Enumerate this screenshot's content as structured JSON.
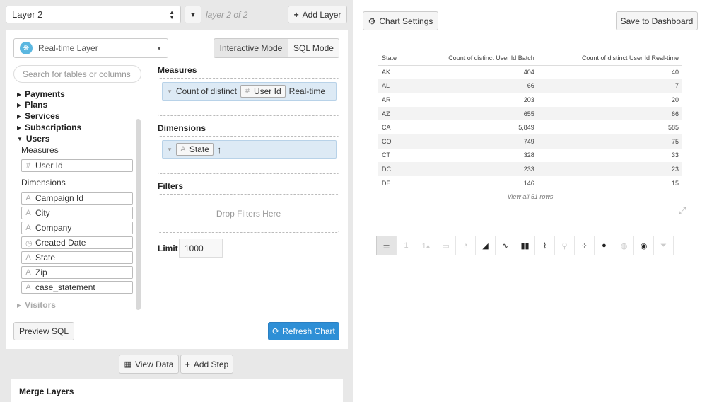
{
  "header": {
    "layer_select": "Layer 2",
    "layer_of": "layer 2 of 2",
    "add_layer": "Add Layer"
  },
  "layer": {
    "type": "Real-time Layer",
    "interactive_mode": "Interactive Mode",
    "sql_mode": "SQL Mode",
    "search_placeholder": "Search for tables or columns"
  },
  "tree": {
    "tables": [
      "Payments",
      "Plans",
      "Services",
      "Subscriptions"
    ],
    "expanded": "Users",
    "measures_label": "Measures",
    "measures": [
      "User Id"
    ],
    "dimensions_label": "Dimensions",
    "dimensions": [
      {
        "label": "Campaign Id",
        "icon": "text-icon"
      },
      {
        "label": "City",
        "icon": "text-icon"
      },
      {
        "label": "Company",
        "icon": "text-icon"
      },
      {
        "label": "Created Date",
        "icon": "clock-icon"
      },
      {
        "label": "State",
        "icon": "text-icon"
      },
      {
        "label": "Zip",
        "icon": "text-icon"
      },
      {
        "label": "case_statement",
        "icon": "text-icon"
      }
    ],
    "collapsed_last": "Visitors"
  },
  "query": {
    "measures_title": "Measures",
    "measure_prefix": "Count of distinct",
    "measure_field": "User Id",
    "measure_suffix": "Real-time",
    "dimensions_title": "Dimensions",
    "dimension_field": "State",
    "filters_title": "Filters",
    "drop_filters": "Drop Filters Here",
    "limit_label": "Limit",
    "limit_value": "1000",
    "preview_sql": "Preview SQL",
    "refresh_chart": "Refresh Chart"
  },
  "footer": {
    "view_data": "View Data",
    "add_step": "Add Step",
    "merge_layers": "Merge Layers"
  },
  "right": {
    "chart_settings": "Chart Settings",
    "save_dashboard": "Save to Dashboard",
    "view_all": "View all 51 rows"
  },
  "table": {
    "headers": [
      "State",
      "Count of distinct User Id Batch",
      "Count of distinct User Id Real-time"
    ],
    "rows": [
      [
        "AK",
        "404",
        "40"
      ],
      [
        "AL",
        "66",
        "7"
      ],
      [
        "AR",
        "203",
        "20"
      ],
      [
        "AZ",
        "655",
        "66"
      ],
      [
        "CA",
        "5,849",
        "585"
      ],
      [
        "CO",
        "749",
        "75"
      ],
      [
        "CT",
        "328",
        "33"
      ],
      [
        "DC",
        "233",
        "23"
      ],
      [
        "DE",
        "146",
        "15"
      ]
    ]
  },
  "chart_types": [
    {
      "name": "table-chart-icon",
      "glyph": "☰",
      "state": "active"
    },
    {
      "name": "number-icon",
      "glyph": "1",
      "state": "off"
    },
    {
      "name": "number-trend-icon",
      "glyph": "1▴",
      "state": "off"
    },
    {
      "name": "progress-icon",
      "glyph": "▭",
      "state": "off"
    },
    {
      "name": "pie-icon",
      "glyph": "◔",
      "state": "off"
    },
    {
      "name": "area-icon",
      "glyph": "◢",
      "state": "on"
    },
    {
      "name": "line-icon",
      "glyph": "∿",
      "state": "on"
    },
    {
      "name": "bar-icon",
      "glyph": "▮▮",
      "state": "on"
    },
    {
      "name": "bar-line-icon",
      "glyph": "⌇",
      "state": "on"
    },
    {
      "name": "funnel-icon",
      "glyph": "⚲",
      "state": "off"
    },
    {
      "name": "scatter-icon",
      "glyph": "⁘",
      "state": "on"
    },
    {
      "name": "bubble-icon",
      "glyph": "●",
      "state": "on"
    },
    {
      "name": "globe-icon",
      "glyph": "◍",
      "state": "off"
    },
    {
      "name": "world-map-icon",
      "glyph": "◉",
      "state": "on"
    },
    {
      "name": "filter-icon",
      "glyph": "⏷",
      "state": "off"
    }
  ]
}
